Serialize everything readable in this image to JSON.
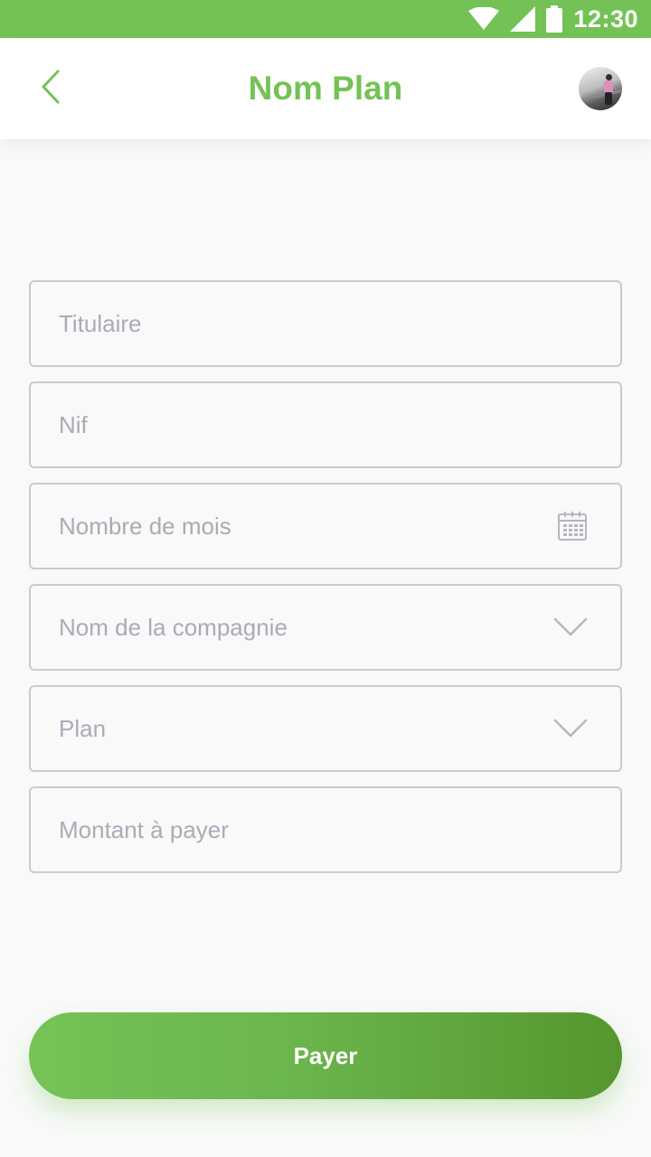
{
  "status_bar": {
    "time": "12:30",
    "icons": [
      "wifi-icon",
      "signal-icon",
      "battery-icon"
    ],
    "background": "#74c255"
  },
  "app_bar": {
    "title": "Nom Plan",
    "back_icon": "chevron-left-icon",
    "avatar": "user-avatar",
    "accent": "#74c255"
  },
  "form": {
    "fields": [
      {
        "placeholder": "Titulaire",
        "icon": ""
      },
      {
        "placeholder": "Nif",
        "icon": ""
      },
      {
        "placeholder": "Nombre de mois",
        "icon": "calendar-icon"
      },
      {
        "placeholder": "Nom de la compagnie",
        "icon": "chevron-down-icon"
      },
      {
        "placeholder": "Plan",
        "icon": "chevron-down-icon"
      },
      {
        "placeholder": "Montant à payer",
        "icon": ""
      }
    ]
  },
  "pay_button": {
    "label": "Payer",
    "gradient_start": "#76c357",
    "gradient_end": "#55962d"
  }
}
